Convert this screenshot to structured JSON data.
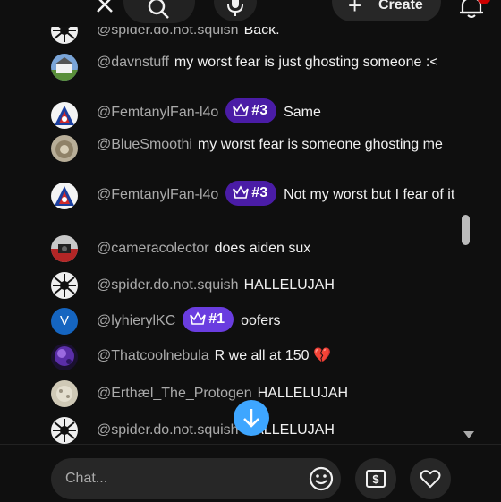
{
  "header": {
    "create_label": "Create"
  },
  "messages": [
    {
      "author": "@spider.do.not.squish",
      "body": "Back."
    },
    {
      "author": "@davnstuff",
      "body": "my worst fear is just ghosting someone :<"
    },
    {
      "author": "@FemtanylFan-l4o",
      "badge": "#3",
      "body": "Same"
    },
    {
      "author": "@BlueSmoothi",
      "body": "my worst fear is someone ghosting me"
    },
    {
      "author": "@FemtanylFan-l4o",
      "badge": "#3",
      "body": "Not my worst but I fear of it"
    },
    {
      "author": "@cameracolector",
      "body": "does aiden sux"
    },
    {
      "author": "@spider.do.not.squish",
      "body": "HALLELUJAH"
    },
    {
      "author": "@lyhierylKC",
      "avatar_letter": "V",
      "badge": "#1",
      "body": "oofers"
    },
    {
      "author": "@Thatcoolnebula",
      "body": "R we all at 150 💔"
    },
    {
      "author": "@Erthæl_The_Protogen",
      "body": "HALLELUJAH"
    },
    {
      "author": "@spider.do.not.squish",
      "body": "HALLELUJAH"
    }
  ],
  "input": {
    "placeholder": "Chat..."
  },
  "colors": {
    "background": "#0f0f0f",
    "author": "#aaaaaa",
    "badge": "#4a1ca6",
    "accent": "#3ea6ff"
  }
}
